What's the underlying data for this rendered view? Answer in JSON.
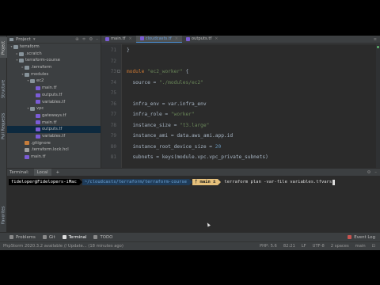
{
  "project_panel": {
    "title": "Project",
    "tree": [
      {
        "label": "terraform",
        "depth": 0,
        "type": "folder",
        "expanded": true
      },
      {
        "label": ".scratch",
        "depth": 1,
        "type": "folder",
        "expanded": false
      },
      {
        "label": "terraform-course",
        "depth": 1,
        "type": "folder",
        "expanded": true
      },
      {
        "label": ".terraform",
        "depth": 2,
        "type": "folder",
        "expanded": false
      },
      {
        "label": "modules",
        "depth": 2,
        "type": "folder",
        "expanded": true
      },
      {
        "label": "ec2",
        "depth": 3,
        "type": "folder",
        "expanded": true
      },
      {
        "label": "main.tf",
        "depth": 4,
        "type": "tf"
      },
      {
        "label": "outputs.tf",
        "depth": 4,
        "type": "tf"
      },
      {
        "label": "variables.tf",
        "depth": 4,
        "type": "tf"
      },
      {
        "label": "vpc",
        "depth": 3,
        "type": "folder",
        "expanded": true
      },
      {
        "label": "gateways.tf",
        "depth": 4,
        "type": "tf"
      },
      {
        "label": "main.tf",
        "depth": 4,
        "type": "tf"
      },
      {
        "label": "outputs.tf",
        "depth": 4,
        "type": "tf",
        "selected": true
      },
      {
        "label": "variables.tf",
        "depth": 4,
        "type": "tf"
      },
      {
        "label": ".gitignore",
        "depth": 2,
        "type": "git"
      },
      {
        "label": ".terraform.lock.hcl",
        "depth": 2,
        "type": "txt"
      },
      {
        "label": "main.tf",
        "depth": 2,
        "type": "tf"
      }
    ]
  },
  "left_strip": {
    "tabs": [
      "Project",
      "Structure",
      "Pull Requests",
      "Favorites"
    ]
  },
  "editor_tabs": [
    {
      "label": "main.tf",
      "active": false
    },
    {
      "label": "cloudcasts.tf",
      "active": true
    },
    {
      "label": "outputs.tf",
      "active": false
    }
  ],
  "editor": {
    "line_numbers": [
      "71",
      "72",
      "73",
      "74",
      "75",
      "76",
      "77",
      "78",
      "79",
      "80",
      "81"
    ],
    "lines": {
      "l71": "}",
      "l73_kw": "module",
      "l73_str": "\"ec2_worker\"",
      "l73_rest": " {",
      "l74_key": "  source = ",
      "l74_str": "\"./modules/ec2\"",
      "l76": "  infra_env = var.infra_env",
      "l77_key": "  infra_role = ",
      "l77_str": "\"worker\"",
      "l78_key": "  instance_size = ",
      "l78_str": "\"t3.large\"",
      "l79": "  instance_ami = data.aws_ami.app.id",
      "l80_key": "  instance_root_device_size = ",
      "l80_num": "20",
      "l81": "  subnets = keys(module.vpc.vpc_private_subnets)"
    }
  },
  "terminal": {
    "tabs": [
      "Terminal:",
      "Local",
      "+"
    ],
    "user": "fideloper@Fidelopers-iMac",
    "path": "~/cloudcasts/terraform/terraform-course",
    "branch": "ᚠ main ±",
    "command": "terraform plan -var-file variables.tfvars"
  },
  "tool_tabs": [
    {
      "label": "Problems",
      "active": false
    },
    {
      "label": "Git",
      "active": false
    },
    {
      "label": "Terminal",
      "active": true
    },
    {
      "label": "TODO",
      "active": false
    }
  ],
  "event_log": "Event Log",
  "status_bar": {
    "left": "PhpStorm 2020.3.2 available // Update... (18 minutes ago)",
    "php": "PHP: 5.6",
    "position": "82:21",
    "line_sep": "LF",
    "encoding": "UTF-8",
    "indent": "2 spaces",
    "branch": "main"
  },
  "colors": {
    "accent": "#4a88c7",
    "terminal_path_bg": "#1f3b58",
    "branch_bg": "#e5c07b"
  }
}
